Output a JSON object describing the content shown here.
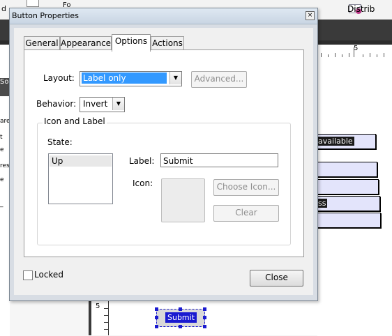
{
  "app": {
    "left_fragment": "d",
    "toolbar_fragment": "Fo",
    "distribute_label": "Distrib",
    "ruler_number": "5",
    "left_pane_dark_text": "Sor",
    "left_pane_fragments": [
      "are",
      "t",
      "e",
      "res",
      "e",
      "_"
    ],
    "vruler_number": "5"
  },
  "form_fields": [
    {
      "text": "available",
      "selected": true
    },
    {
      "text": "",
      "selected": false
    },
    {
      "text": "",
      "selected": false
    },
    {
      "text": "ss",
      "selected": true
    },
    {
      "text": "",
      "selected": false
    }
  ],
  "submit_widget_label": "Submit",
  "dialog": {
    "title": "Button Properties",
    "close_glyph": "×",
    "tabs": [
      {
        "label": "General",
        "active": false
      },
      {
        "label": "Appearance",
        "active": false
      },
      {
        "label": "Options",
        "active": true
      },
      {
        "label": "Actions",
        "active": false
      }
    ],
    "layout": {
      "label": "Layout:",
      "value": "Label only",
      "arrow": "▼"
    },
    "advanced_button": "Advanced...",
    "behavior": {
      "label": "Behavior:",
      "value": "Invert",
      "arrow": "▼"
    },
    "icon_and_label": {
      "title": "Icon and Label",
      "state_label": "State:",
      "states": [
        "Up"
      ],
      "label_label": "Label:",
      "label_value": "Submit",
      "icon_label": "Icon:",
      "choose_icon_button": "Choose Icon...",
      "clear_button": "Clear"
    },
    "locked_label": "Locked",
    "locked_checked": false,
    "close_button": "Close"
  }
}
